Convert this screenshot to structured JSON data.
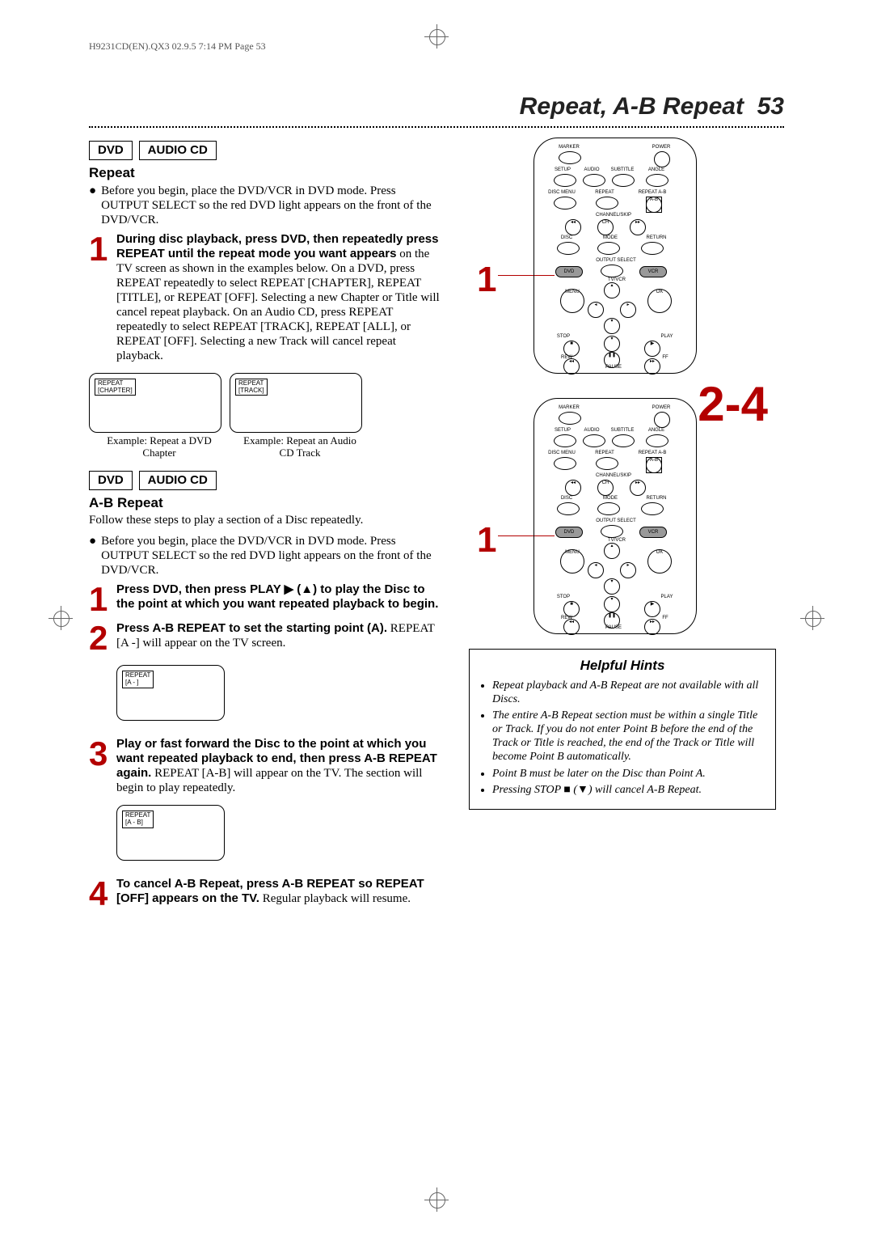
{
  "header_line": "H9231CD(EN).QX3  02.9.5 7:14 PM  Page 53",
  "page_title": "Repeat, A-B Repeat",
  "page_number": "53",
  "mode_dvd": "DVD",
  "mode_cd": "AUDIO CD",
  "repeat": {
    "heading": "Repeat",
    "intro": "Before you begin, place the DVD/VCR in DVD mode. Press OUTPUT SELECT so the red DVD light appears on the front of the DVD/VCR.",
    "step1_bold": "During disc playback, press DVD, then repeatedly press REPEAT until the repeat mode you want appears",
    "step1_rest": " on the TV screen as shown in the examples below. On a DVD, press REPEAT repeatedly to select REPEAT [CHAPTER], REPEAT [TITLE], or REPEAT [OFF]. Selecting a new Chapter or Title will cancel repeat playback. On an Audio CD, press REPEAT repeatedly to select REPEAT [TRACK], REPEAT [ALL], or REPEAT [OFF]. Selecting a new Track will cancel repeat playback.",
    "tv1_l1": "REPEAT",
    "tv1_l2": "[CHAPTER]",
    "tv1_cap": "Example: Repeat a DVD Chapter",
    "tv2_l1": "REPEAT",
    "tv2_l2": "[TRACK]",
    "tv2_cap": "Example: Repeat an Audio CD Track"
  },
  "ab": {
    "heading": "A-B Repeat",
    "line1": "Follow these steps to play a section of a Disc repeatedly.",
    "line2": "Before you begin, place the DVD/VCR in DVD mode. Press OUTPUT SELECT so the red DVD light  appears on the front of the DVD/VCR.",
    "s1": "Press DVD, then press PLAY ▶ (▲) to play the Disc to the point at which you want repeated playback to begin.",
    "s2a": "Press A-B REPEAT to set the starting point (A).",
    "s2b": " REPEAT [A -] will appear on the TV screen.",
    "tvA_l1": "REPEAT",
    "tvA_l2": "[A - ]",
    "s3a": "Play or fast forward the Disc to the point at which you want repeated playback to end, then press A-B REPEAT again.",
    "s3b": " REPEAT [A-B] will appear on the TV. The section will begin to play repeatedly.",
    "tvB_l1": "REPEAT",
    "tvB_l2": "[A - B]",
    "s4a": "To cancel A-B Repeat, press A-B REPEAT so REPEAT [OFF] appears on the TV.",
    "s4b": " Regular playback will resume."
  },
  "hints": {
    "title": "Helpful Hints",
    "items": [
      "Repeat playback and A-B Repeat are not available with all Discs.",
      "The entire A-B Repeat section must be within a single Title or Track. If you do not enter Point B before the end of the Track or Title is reached, the end of the Track or Title will become Point B automatically.",
      "Point B must be later on the Disc than Point A.",
      "Pressing STOP ■ (▼) will cancel A-B Repeat."
    ]
  },
  "remote_labels": {
    "marker": "MARKER",
    "power": "POWER",
    "setup": "SETUP",
    "audio": "AUDIO",
    "subtitle": "SUBTITLE",
    "angle": "ANGLE",
    "discmenu": "DISC MENU",
    "repeat": "REPEAT",
    "repeat_ab": "REPEAT A-B",
    "disc": "DISC",
    "mode": "MODE",
    "return": "RETURN",
    "dvd": "DVD",
    "output": "OUTPUT SELECT",
    "vcr": "VCR",
    "menu": "MENU",
    "ok": "OK",
    "stop": "STOP",
    "play": "PLAY",
    "rew": "REW",
    "pause": "PAUSE",
    "ff": "FF",
    "chskip": "CHANNEL/SKIP",
    "tvvcr": "TV/VCR"
  },
  "nums": {
    "n1": "1",
    "n2": "2",
    "n3": "3",
    "n4": "4",
    "n24": "2-4"
  }
}
